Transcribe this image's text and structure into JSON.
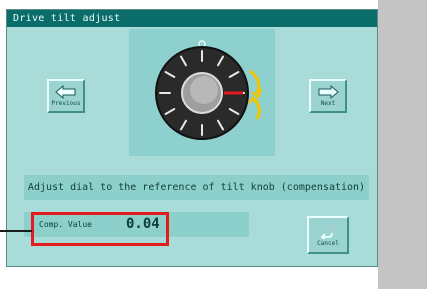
{
  "window": {
    "title": "Drive tilt adjust"
  },
  "nav": {
    "previous_label": "Previous",
    "next_label": "Next"
  },
  "dial": {
    "icon": "tilt-knob-dial-icon",
    "rotation_arrows_icon": "rotate-arrows-icon",
    "accent_color": "#e31b1b"
  },
  "message": "Adjust dial to the reference of tilt knob (compensation)",
  "comp": {
    "label": "Comp. Value",
    "value": "0.04"
  },
  "cancel": {
    "label": "Cancel",
    "icon": "undo-arrow-icon"
  },
  "colors": {
    "window_bg": "#a9dcd8",
    "title_bg": "#0b6d6a",
    "highlight": "#e31b1b"
  }
}
